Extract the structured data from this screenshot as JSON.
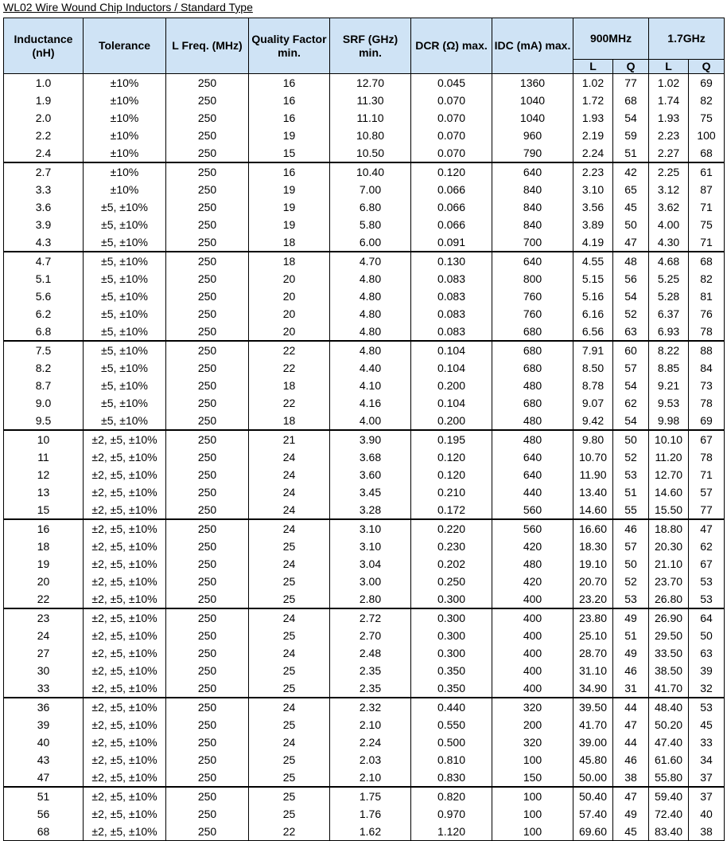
{
  "title": "WL02 Wire Wound Chip Inductors / Standard Type",
  "headers": {
    "inductance": "Inductance (nH)",
    "tolerance": "Tolerance",
    "lfreq": "L Freq. (MHz)",
    "qf": "Quality Factor min.",
    "srf": "SRF (GHz) min.",
    "dcr": "DCR (Ω) max.",
    "idc": "IDC (mA) max.",
    "f900": "900MHz",
    "f17": "1.7GHz",
    "l": "L",
    "q": "Q"
  },
  "rows": [
    [
      "1.0",
      "±10%",
      "250",
      "16",
      "12.70",
      "0.045",
      "1360",
      "1.02",
      "77",
      "1.02",
      "69"
    ],
    [
      "1.9",
      "±10%",
      "250",
      "16",
      "11.30",
      "0.070",
      "1040",
      "1.72",
      "68",
      "1.74",
      "82"
    ],
    [
      "2.0",
      "±10%",
      "250",
      "16",
      "11.10",
      "0.070",
      "1040",
      "1.93",
      "54",
      "1.93",
      "75"
    ],
    [
      "2.2",
      "±10%",
      "250",
      "19",
      "10.80",
      "0.070",
      "960",
      "2.19",
      "59",
      "2.23",
      "100"
    ],
    [
      "2.4",
      "±10%",
      "250",
      "15",
      "10.50",
      "0.070",
      "790",
      "2.24",
      "51",
      "2.27",
      "68"
    ],
    [
      "2.7",
      "±10%",
      "250",
      "16",
      "10.40",
      "0.120",
      "640",
      "2.23",
      "42",
      "2.25",
      "61"
    ],
    [
      "3.3",
      "±10%",
      "250",
      "19",
      "7.00",
      "0.066",
      "840",
      "3.10",
      "65",
      "3.12",
      "87"
    ],
    [
      "3.6",
      "±5, ±10%",
      "250",
      "19",
      "6.80",
      "0.066",
      "840",
      "3.56",
      "45",
      "3.62",
      "71"
    ],
    [
      "3.9",
      "±5, ±10%",
      "250",
      "19",
      "5.80",
      "0.066",
      "840",
      "3.89",
      "50",
      "4.00",
      "75"
    ],
    [
      "4.3",
      "±5, ±10%",
      "250",
      "18",
      "6.00",
      "0.091",
      "700",
      "4.19",
      "47",
      "4.30",
      "71"
    ],
    [
      "4.7",
      "±5, ±10%",
      "250",
      "18",
      "4.70",
      "0.130",
      "640",
      "4.55",
      "48",
      "4.68",
      "68"
    ],
    [
      "5.1",
      "±5, ±10%",
      "250",
      "20",
      "4.80",
      "0.083",
      "800",
      "5.15",
      "56",
      "5.25",
      "82"
    ],
    [
      "5.6",
      "±5, ±10%",
      "250",
      "20",
      "4.80",
      "0.083",
      "760",
      "5.16",
      "54",
      "5.28",
      "81"
    ],
    [
      "6.2",
      "±5, ±10%",
      "250",
      "20",
      "4.80",
      "0.083",
      "760",
      "6.16",
      "52",
      "6.37",
      "76"
    ],
    [
      "6.8",
      "±5, ±10%",
      "250",
      "20",
      "4.80",
      "0.083",
      "680",
      "6.56",
      "63",
      "6.93",
      "78"
    ],
    [
      "7.5",
      "±5, ±10%",
      "250",
      "22",
      "4.80",
      "0.104",
      "680",
      "7.91",
      "60",
      "8.22",
      "88"
    ],
    [
      "8.2",
      "±5, ±10%",
      "250",
      "22",
      "4.40",
      "0.104",
      "680",
      "8.50",
      "57",
      "8.85",
      "84"
    ],
    [
      "8.7",
      "±5, ±10%",
      "250",
      "18",
      "4.10",
      "0.200",
      "480",
      "8.78",
      "54",
      "9.21",
      "73"
    ],
    [
      "9.0",
      "±5, ±10%",
      "250",
      "22",
      "4.16",
      "0.104",
      "680",
      "9.07",
      "62",
      "9.53",
      "78"
    ],
    [
      "9.5",
      "±5, ±10%",
      "250",
      "18",
      "4.00",
      "0.200",
      "480",
      "9.42",
      "54",
      "9.98",
      "69"
    ],
    [
      "10",
      "±2, ±5, ±10%",
      "250",
      "21",
      "3.90",
      "0.195",
      "480",
      "9.80",
      "50",
      "10.10",
      "67"
    ],
    [
      "11",
      "±2, ±5, ±10%",
      "250",
      "24",
      "3.68",
      "0.120",
      "640",
      "10.70",
      "52",
      "11.20",
      "78"
    ],
    [
      "12",
      "±2, ±5, ±10%",
      "250",
      "24",
      "3.60",
      "0.120",
      "640",
      "11.90",
      "53",
      "12.70",
      "71"
    ],
    [
      "13",
      "±2, ±5, ±10%",
      "250",
      "24",
      "3.45",
      "0.210",
      "440",
      "13.40",
      "51",
      "14.60",
      "57"
    ],
    [
      "15",
      "±2, ±5, ±10%",
      "250",
      "24",
      "3.28",
      "0.172",
      "560",
      "14.60",
      "55",
      "15.50",
      "77"
    ],
    [
      "16",
      "±2, ±5, ±10%",
      "250",
      "24",
      "3.10",
      "0.220",
      "560",
      "16.60",
      "46",
      "18.80",
      "47"
    ],
    [
      "18",
      "±2, ±5, ±10%",
      "250",
      "25",
      "3.10",
      "0.230",
      "420",
      "18.30",
      "57",
      "20.30",
      "62"
    ],
    [
      "19",
      "±2, ±5, ±10%",
      "250",
      "24",
      "3.04",
      "0.202",
      "480",
      "19.10",
      "50",
      "21.10",
      "67"
    ],
    [
      "20",
      "±2, ±5, ±10%",
      "250",
      "25",
      "3.00",
      "0.250",
      "420",
      "20.70",
      "52",
      "23.70",
      "53"
    ],
    [
      "22",
      "±2, ±5, ±10%",
      "250",
      "25",
      "2.80",
      "0.300",
      "400",
      "23.20",
      "53",
      "26.80",
      "53"
    ],
    [
      "23",
      "±2, ±5, ±10%",
      "250",
      "24",
      "2.72",
      "0.300",
      "400",
      "23.80",
      "49",
      "26.90",
      "64"
    ],
    [
      "24",
      "±2, ±5, ±10%",
      "250",
      "25",
      "2.70",
      "0.300",
      "400",
      "25.10",
      "51",
      "29.50",
      "50"
    ],
    [
      "27",
      "±2, ±5, ±10%",
      "250",
      "24",
      "2.48",
      "0.300",
      "400",
      "28.70",
      "49",
      "33.50",
      "63"
    ],
    [
      "30",
      "±2, ±5, ±10%",
      "250",
      "25",
      "2.35",
      "0.350",
      "400",
      "31.10",
      "46",
      "38.50",
      "39"
    ],
    [
      "33",
      "±2, ±5, ±10%",
      "250",
      "25",
      "2.35",
      "0.350",
      "400",
      "34.90",
      "31",
      "41.70",
      "32"
    ],
    [
      "36",
      "±2, ±5, ±10%",
      "250",
      "24",
      "2.32",
      "0.440",
      "320",
      "39.50",
      "44",
      "48.40",
      "53"
    ],
    [
      "39",
      "±2, ±5, ±10%",
      "250",
      "25",
      "2.10",
      "0.550",
      "200",
      "41.70",
      "47",
      "50.20",
      "45"
    ],
    [
      "40",
      "±2, ±5, ±10%",
      "250",
      "24",
      "2.24",
      "0.500",
      "320",
      "39.00",
      "44",
      "47.40",
      "33"
    ],
    [
      "43",
      "±2, ±5, ±10%",
      "250",
      "25",
      "2.03",
      "0.810",
      "100",
      "45.80",
      "46",
      "61.60",
      "34"
    ],
    [
      "47",
      "±2, ±5, ±10%",
      "250",
      "25",
      "2.10",
      "0.830",
      "150",
      "50.00",
      "38",
      "55.80",
      "37"
    ],
    [
      "51",
      "±2, ±5, ±10%",
      "250",
      "25",
      "1.75",
      "0.820",
      "100",
      "50.40",
      "47",
      "59.40",
      "37"
    ],
    [
      "56",
      "±2, ±5, ±10%",
      "250",
      "25",
      "1.76",
      "0.970",
      "100",
      "57.40",
      "49",
      "72.40",
      "40"
    ],
    [
      "68",
      "±2, ±5, ±10%",
      "250",
      "22",
      "1.62",
      "1.120",
      "100",
      "69.60",
      "45",
      "83.40",
      "38"
    ]
  ]
}
